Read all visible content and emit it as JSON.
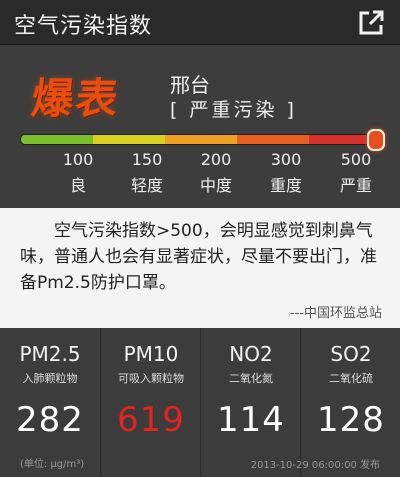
{
  "header": {
    "title": "空气污染指数",
    "share_icon": "share-icon"
  },
  "status": {
    "badge": "爆表",
    "city": "邢台",
    "level": "[ 严重污染 ]",
    "aqi_marker_value": 520,
    "scale_max": 520,
    "scale_colors": [
      "#7cbf2a",
      "#d9d020",
      "#f0a020",
      "#e86020",
      "#d8302a"
    ],
    "ticks": [
      {
        "value": "100",
        "label": "良"
      },
      {
        "value": "150",
        "label": "轻度"
      },
      {
        "value": "200",
        "label": "中度"
      },
      {
        "value": "300",
        "label": "重度"
      },
      {
        "value": "500",
        "label": "严重"
      }
    ]
  },
  "message": {
    "text": "空气污染指数>500，会明显感觉到刺鼻气味，普通人也会有显著症状，尽量不要出门，准备Pm2.5防护口罩。",
    "source": "---中国环监总站"
  },
  "pollutants": [
    {
      "name": "PM2.5",
      "desc": "入肺颗粒物",
      "value": "282",
      "color": "#ffffff"
    },
    {
      "name": "PM10",
      "desc": "可吸入颗粒物",
      "value": "619",
      "color": "#e0251e"
    },
    {
      "name": "NO2",
      "desc": "二氧化氮",
      "value": "114",
      "color": "#ffffff"
    },
    {
      "name": "SO2",
      "desc": "二氧化硫",
      "value": "128",
      "color": "#ffffff"
    }
  ],
  "footer": {
    "unit": "(单位: μg/m³)",
    "published": "2013-10-29 06:00:00 发布"
  }
}
